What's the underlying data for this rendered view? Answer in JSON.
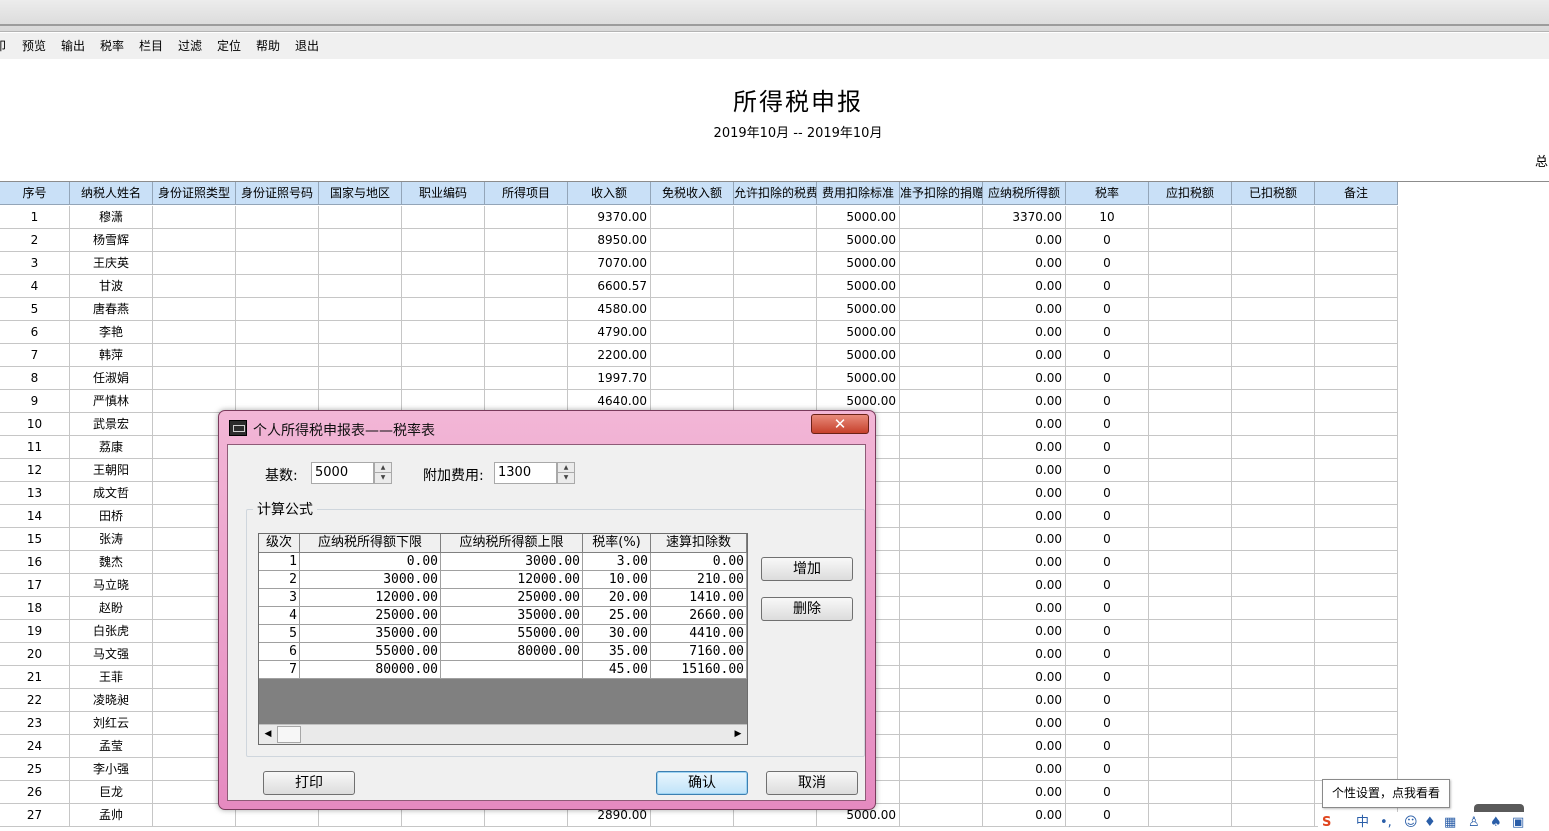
{
  "menu": [
    "印",
    "预览",
    "输出",
    "税率",
    "栏目",
    "过滤",
    "定位",
    "帮助",
    "退出"
  ],
  "report": {
    "title": "所得税申报",
    "period": "2019年10月 -- 2019年10月",
    "total_label": "总"
  },
  "grid": {
    "columns": [
      "序号",
      "纳税人姓名",
      "身份证照类型",
      "身份证照号码",
      "国家与地区",
      "职业编码",
      "所得项目",
      "收入额",
      "免税收入额",
      "允许扣除的税费",
      "费用扣除标准",
      "准予扣除的捐赠",
      "应纳税所得额",
      "税率",
      "应扣税额",
      "已扣税额",
      "备注"
    ],
    "rows": [
      {
        "no": "1",
        "name": "穆潇",
        "income": "9370.00",
        "deduction": "5000.00",
        "taxable": "3370.00",
        "rate": "10"
      },
      {
        "no": "2",
        "name": "杨雪辉",
        "income": "8950.00",
        "deduction": "5000.00",
        "taxable": "0.00",
        "rate": "0"
      },
      {
        "no": "3",
        "name": "王庆英",
        "income": "7070.00",
        "deduction": "5000.00",
        "taxable": "0.00",
        "rate": "0"
      },
      {
        "no": "4",
        "name": "甘波",
        "income": "6600.57",
        "deduction": "5000.00",
        "taxable": "0.00",
        "rate": "0"
      },
      {
        "no": "5",
        "name": "唐春燕",
        "income": "4580.00",
        "deduction": "5000.00",
        "taxable": "0.00",
        "rate": "0"
      },
      {
        "no": "6",
        "name": "李艳",
        "income": "4790.00",
        "deduction": "5000.00",
        "taxable": "0.00",
        "rate": "0"
      },
      {
        "no": "7",
        "name": "韩萍",
        "income": "2200.00",
        "deduction": "5000.00",
        "taxable": "0.00",
        "rate": "0"
      },
      {
        "no": "8",
        "name": "任淑娟",
        "income": "1997.70",
        "deduction": "5000.00",
        "taxable": "0.00",
        "rate": "0"
      },
      {
        "no": "9",
        "name": "严慎林",
        "income": "4640.00",
        "deduction": "5000.00",
        "taxable": "0.00",
        "rate": "0"
      },
      {
        "no": "10",
        "name": "武景宏",
        "income": "",
        "deduction": "",
        "taxable": "0.00",
        "rate": "0"
      },
      {
        "no": "11",
        "name": "荔康",
        "income": "",
        "deduction": "",
        "taxable": "0.00",
        "rate": "0"
      },
      {
        "no": "12",
        "name": "王朝阳",
        "income": "",
        "deduction": "",
        "taxable": "0.00",
        "rate": "0"
      },
      {
        "no": "13",
        "name": "成文哲",
        "income": "",
        "deduction": "",
        "taxable": "0.00",
        "rate": "0"
      },
      {
        "no": "14",
        "name": "田桥",
        "income": "",
        "deduction": "",
        "taxable": "0.00",
        "rate": "0"
      },
      {
        "no": "15",
        "name": "张涛",
        "income": "",
        "deduction": "",
        "taxable": "0.00",
        "rate": "0"
      },
      {
        "no": "16",
        "name": "魏杰",
        "income": "",
        "deduction": "",
        "taxable": "0.00",
        "rate": "0"
      },
      {
        "no": "17",
        "name": "马立晓",
        "income": "",
        "deduction": "",
        "taxable": "0.00",
        "rate": "0"
      },
      {
        "no": "18",
        "name": "赵盼",
        "income": "",
        "deduction": "",
        "taxable": "0.00",
        "rate": "0"
      },
      {
        "no": "19",
        "name": "白张虎",
        "income": "",
        "deduction": "",
        "taxable": "0.00",
        "rate": "0"
      },
      {
        "no": "20",
        "name": "马文强",
        "income": "",
        "deduction": "",
        "taxable": "0.00",
        "rate": "0"
      },
      {
        "no": "21",
        "name": "王菲",
        "income": "",
        "deduction": "",
        "taxable": "0.00",
        "rate": "0"
      },
      {
        "no": "22",
        "name": "凌晓昶",
        "income": "",
        "deduction": "",
        "taxable": "0.00",
        "rate": "0"
      },
      {
        "no": "23",
        "name": "刘红云",
        "income": "",
        "deduction": "",
        "taxable": "0.00",
        "rate": "0"
      },
      {
        "no": "24",
        "name": "孟莹",
        "income": "",
        "deduction": "",
        "taxable": "0.00",
        "rate": "0"
      },
      {
        "no": "25",
        "name": "李小强",
        "income": "",
        "deduction": "",
        "taxable": "0.00",
        "rate": "0"
      },
      {
        "no": "26",
        "name": "巨龙",
        "income": "",
        "deduction": "",
        "taxable": "0.00",
        "rate": "0"
      },
      {
        "no": "27",
        "name": "孟帅",
        "income": "2890.00",
        "deduction": "5000.00",
        "taxable": "0.00",
        "rate": "0"
      }
    ]
  },
  "dialog": {
    "title": "个人所得税申报表——税率表",
    "close_glyph": "✕",
    "base_label": "基数:",
    "base_value": "5000",
    "extra_label": "附加费用:",
    "extra_value": "1300",
    "group_label": "计算公式",
    "table": {
      "columns": [
        "级次",
        "应纳税所得额下限",
        "应纳税所得额上限",
        "税率(%)",
        "速算扣除数"
      ],
      "rows": [
        [
          "1",
          "0.00",
          "3000.00",
          "3.00",
          "0.00"
        ],
        [
          "2",
          "3000.00",
          "12000.00",
          "10.00",
          "210.00"
        ],
        [
          "3",
          "12000.00",
          "25000.00",
          "20.00",
          "1410.00"
        ],
        [
          "4",
          "25000.00",
          "35000.00",
          "25.00",
          "2660.00"
        ],
        [
          "5",
          "35000.00",
          "55000.00",
          "30.00",
          "4410.00"
        ],
        [
          "6",
          "55000.00",
          "80000.00",
          "35.00",
          "7160.00"
        ],
        [
          "7",
          "80000.00",
          "",
          "45.00",
          "15160.00"
        ]
      ]
    },
    "buttons": {
      "add": "增加",
      "delete": "删除",
      "print": "打印",
      "ok": "确认",
      "cancel": "取消"
    }
  },
  "tooltip": "个性设置，点我看看",
  "tray": {
    "ime": "中"
  }
}
